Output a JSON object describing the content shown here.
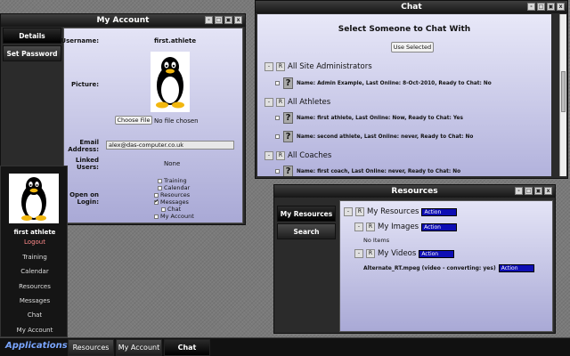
{
  "my_account": {
    "title": "My Account",
    "nav": [
      "Details",
      "Set Password"
    ],
    "labels": {
      "username": "Username:",
      "picture": "Picture:",
      "email": "Email Address:",
      "linked_users": "Linked Users:",
      "open_on_login": "Open on Login:"
    },
    "username": "first.athlete",
    "choose_file": "Choose File",
    "no_file": "No file chosen",
    "email_value": "alex@das-computer.co.uk",
    "linked_users_value": "None",
    "open_on_login_options": [
      {
        "label": "Training",
        "checked": false
      },
      {
        "label": "Calendar",
        "checked": false
      },
      {
        "label": "Resources",
        "checked": false
      },
      {
        "label": "Messages",
        "checked": true
      },
      {
        "label": "Chat",
        "checked": false
      },
      {
        "label": "My Account",
        "checked": false
      }
    ]
  },
  "chat": {
    "title": "Chat",
    "heading": "Select Someone to Chat With",
    "use_selected": "Use Selected",
    "groups": [
      {
        "name": "All Site Administrators",
        "people": [
          "Name: Admin Example, Last Online: 8-Oct-2010,    Ready to Chat: No"
        ]
      },
      {
        "name": "All Athletes",
        "people": [
          "Name: first athlete, Last Online: Now,        Ready to Chat: Yes",
          "Name: second athlete,  Last Online: never,      Ready to Chat: No"
        ]
      },
      {
        "name": "All Coaches",
        "people": [
          "Name: first coach,  Last Online: never,       Ready to Chat: No"
        ]
      }
    ]
  },
  "resources": {
    "title": "Resources",
    "nav": [
      "My Resources",
      "Search"
    ],
    "tree": {
      "root": "My Resources",
      "images": "My Images",
      "no_items": "No Items",
      "videos": "My Videos",
      "video_file": "Alternate_RT.mpeg (video - converting: yes)"
    },
    "action_label": "Action"
  },
  "profile": {
    "name": "first athlete",
    "logout": "Logout",
    "menu": [
      "Training",
      "Calendar",
      "Resources",
      "Messages",
      "Chat",
      "My Account"
    ]
  },
  "taskbar": {
    "applications": "Applications",
    "tabs": [
      "Resources",
      "My Account",
      "Chat"
    ],
    "active_tab": "Chat"
  },
  "window_controls": [
    "-",
    "□",
    "▣",
    "x"
  ],
  "colors": {
    "accent_blue": "#0e0eb4",
    "logout_red": "#ff8a8a",
    "applications_blue": "#7aa6ff"
  }
}
